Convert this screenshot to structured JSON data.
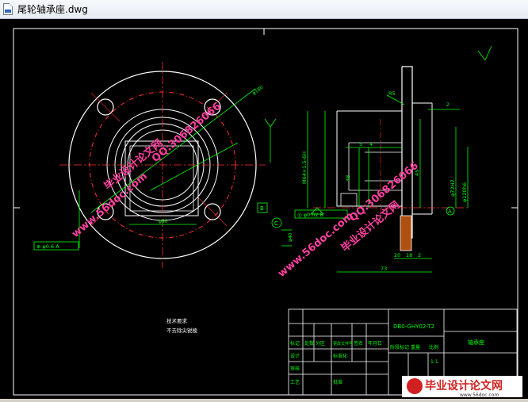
{
  "window": {
    "title": "尾轮轴承座.dwg"
  },
  "drawing": {
    "dims": {
      "phi180": "φ180",
      "phi90": "φ90",
      "phi40": "φ40",
      "r5": "R5",
      "d5": "5",
      "d4": "4",
      "d48": "48",
      "d73": "73",
      "d20": "20",
      "d18": "18",
      "d2": "2",
      "m64": "M64×1.5-6H",
      "t45": "45",
      "h12": "φ120h6",
      "h72": "φ72H7"
    },
    "tolerances": {
      "left": "⊕ φ0.6 A",
      "bottom": "◎ φ0.02 B"
    },
    "datums": {
      "a": "A",
      "b": "B",
      "c": "C"
    },
    "notes": [
      "技术要求",
      "不去除尖锐棱"
    ],
    "titleblock": {
      "drawing_no": "DB0-GHY02-T2",
      "part_name": "轴承座",
      "scale": "1:1",
      "headers": [
        "标记",
        "处数",
        "分区",
        "更改文件号",
        "签名",
        "年月日"
      ],
      "row2": [
        "设计",
        "",
        "",
        "标准化",
        "",
        ""
      ],
      "row3": [
        "审核",
        "",
        "",
        ""
      ],
      "row4": [
        "工艺",
        "",
        "批准",
        ""
      ],
      "labels": [
        "阶段标记",
        "重量",
        "比例"
      ]
    }
  },
  "watermarks": {
    "qq": "QQ:306826066",
    "site": "www.56doc.com",
    "brand": "毕业设计论文网"
  },
  "footer_logo": {
    "brand": "毕业设计论文网",
    "url": "www.56doc.com"
  }
}
